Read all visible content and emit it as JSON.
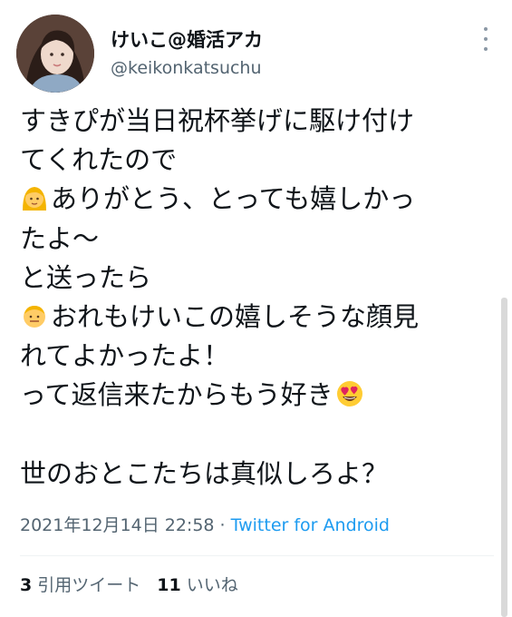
{
  "tweet": {
    "display_name": "けいこ@婚活アカ",
    "handle": "@keikonkatsuchu",
    "lines": [
      {
        "emoji": "",
        "text": "すきぴが当日祝杯挙げに駆け付け"
      },
      {
        "emoji": "",
        "text": "てくれたので"
      },
      {
        "emoji": "woman-face-emoji",
        "text": "ありがとう、とっても嬉しかっ"
      },
      {
        "emoji": "",
        "text": "たよ〜"
      },
      {
        "emoji": "",
        "text": "と送ったら"
      },
      {
        "emoji": "man-face-emoji",
        "text": "おれもけいこの嬉しそうな顔見"
      },
      {
        "emoji": "",
        "text": "れてよかったよ！"
      },
      {
        "emoji": "",
        "text": "って返信来たからもう好き",
        "trailing_emoji": "heart-eyes-emoji"
      },
      {
        "emoji": "",
        "text": ""
      },
      {
        "emoji": "",
        "text": "世のおとこたちは真似しろよ？"
      }
    ],
    "timestamp": "2021年12月14日 22:58",
    "separator": " · ",
    "source": "Twitter for Android",
    "retweet_count": "3",
    "retweet_label": "引用ツイート",
    "like_count": "11",
    "like_label": "いいね"
  },
  "colors": {
    "text": "#0f1419",
    "secondary": "#536471",
    "link": "#1d9bf0"
  }
}
